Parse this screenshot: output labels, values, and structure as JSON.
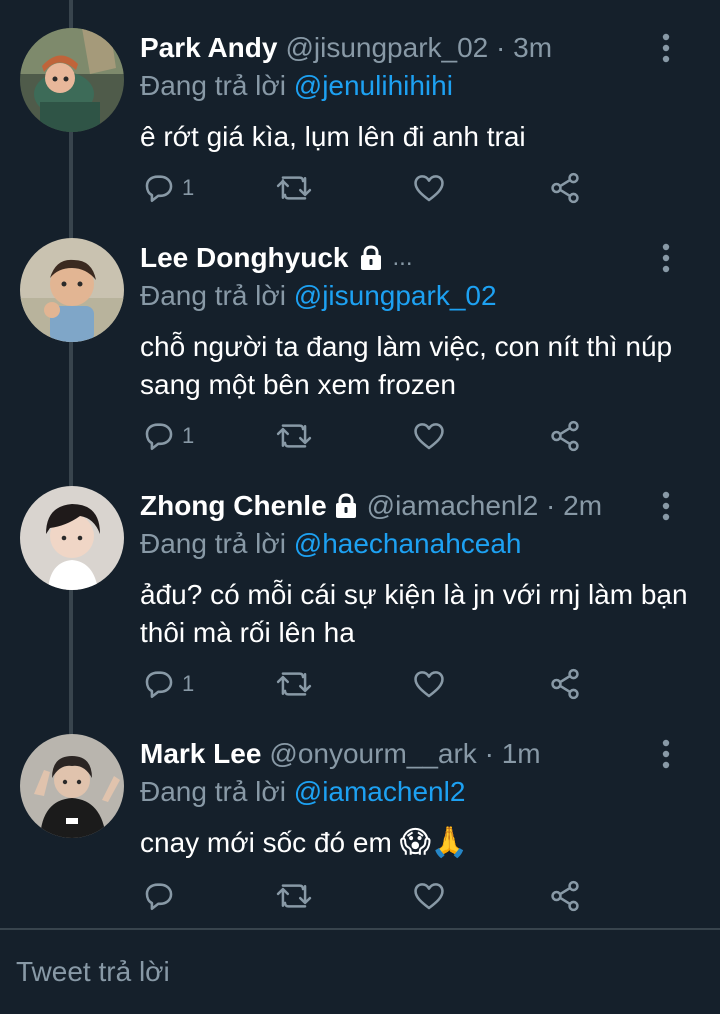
{
  "theme": {
    "background": "#15202b",
    "secondary_text": "#8899a6",
    "accent": "#1da1f2",
    "line": "#38444d"
  },
  "tweets": [
    {
      "name": "Park Andy",
      "handle_time": "@jisungpark_02 · 3m",
      "replying_prefix": "Đang trả lời",
      "replying_to": "@jenulihihihi",
      "text": "ê rớt giá kìa, lụm lên đi anh trai",
      "reply_count": "1",
      "avatar": "cartoon-character-avatar",
      "locked": false
    },
    {
      "name": "Lee Donghyuck",
      "handle_time": "...",
      "replying_prefix": "Đang trả lời",
      "replying_to": "@jisungpark_02",
      "text": "chỗ người ta đang làm việc, con nít thì núp sang một bên xem frozen",
      "reply_count": "1",
      "avatar": "toddler-photo-avatar",
      "locked": true
    },
    {
      "name": "Zhong Chenle",
      "handle_time": "@iamachenl2 · 2m",
      "replying_prefix": "Đang trả lời",
      "replying_to": "@haechanahceah",
      "text": "ảđu? có mỗi cái sự kiện là jn với rnj làm bạn thôi mà rối lên ha",
      "reply_count": "1",
      "avatar": "person-photo-avatar",
      "locked": true
    },
    {
      "name": "Mark Lee",
      "handle_time": "@onyourm__ark · 1m",
      "replying_prefix": "Đang trả lời",
      "replying_to": "@iamachenl2",
      "text": "cnay mới sốc đó em",
      "emojis": "😱🙏",
      "reply_count": "",
      "avatar": "peace-sign-photo-avatar",
      "locked": false
    }
  ],
  "icons": [
    "more-vertical-icon",
    "reply-icon",
    "retweet-icon",
    "like-icon",
    "share-icon",
    "lock-icon"
  ],
  "composer": {
    "placeholder": "Tweet trả lời"
  }
}
